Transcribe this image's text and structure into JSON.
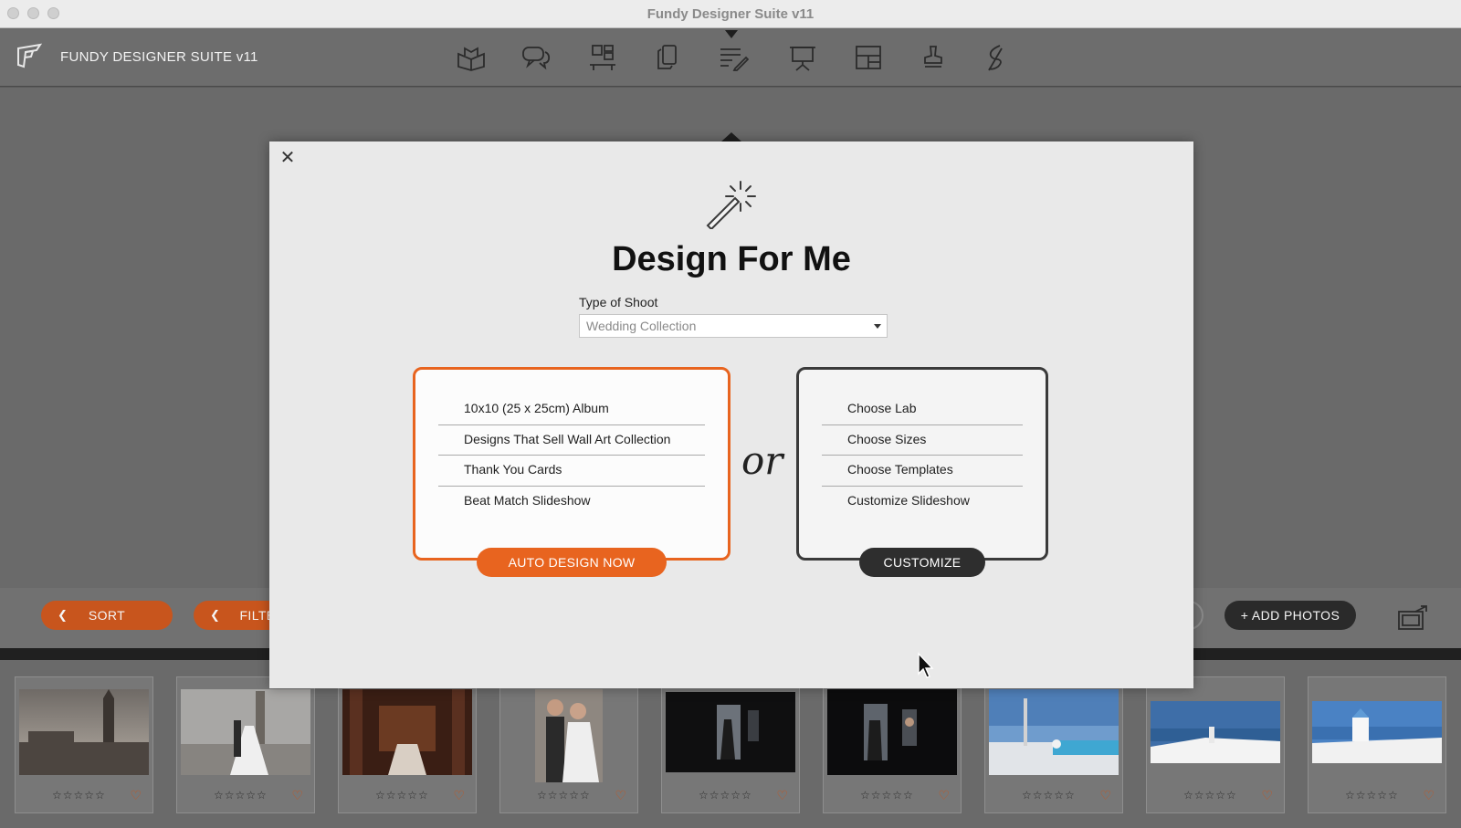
{
  "window": {
    "title": "Fundy Designer Suite v11"
  },
  "app": {
    "name": "FUNDY DESIGNER SUITE v11",
    "tools": [
      "album-icon",
      "chat-icon",
      "wall-art-icon",
      "cards-icon",
      "design-list-icon",
      "presentation-icon",
      "layout-icon",
      "stamp-icon",
      "signature-icon"
    ]
  },
  "bottombar": {
    "sort_label": "SORT",
    "filter_label": "FILTE",
    "add_photos_label": "+ ADD PHOTOS"
  },
  "filmstrip": {
    "rating_glyphs": "☆☆☆☆☆",
    "favorite_glyph": "♡",
    "thumbnails": [
      "london-landmark",
      "couple-bridge",
      "ornate-hall",
      "couple-portrait",
      "dark-doorway",
      "dark-window",
      "poolside-terrace",
      "whitewashed-terrace",
      "white-chapel"
    ]
  },
  "modal": {
    "close_glyph": "✕",
    "title": "Design For Me",
    "shoot_label": "Type of Shoot",
    "shoot_value": "Wedding Collection",
    "auto": {
      "items": [
        "10x10 (25 x 25cm) Album",
        "Designs That Sell Wall Art Collection",
        "Thank You Cards",
        "Beat Match Slideshow"
      ],
      "button": "AUTO DESIGN NOW"
    },
    "or_text": "or",
    "custom": {
      "items": [
        "Choose Lab",
        "Choose Sizes",
        "Choose Templates",
        "Customize Slideshow"
      ],
      "button": "CUSTOMIZE"
    }
  },
  "colors": {
    "accent": "#e8641f",
    "dark": "#2e2e2e"
  }
}
